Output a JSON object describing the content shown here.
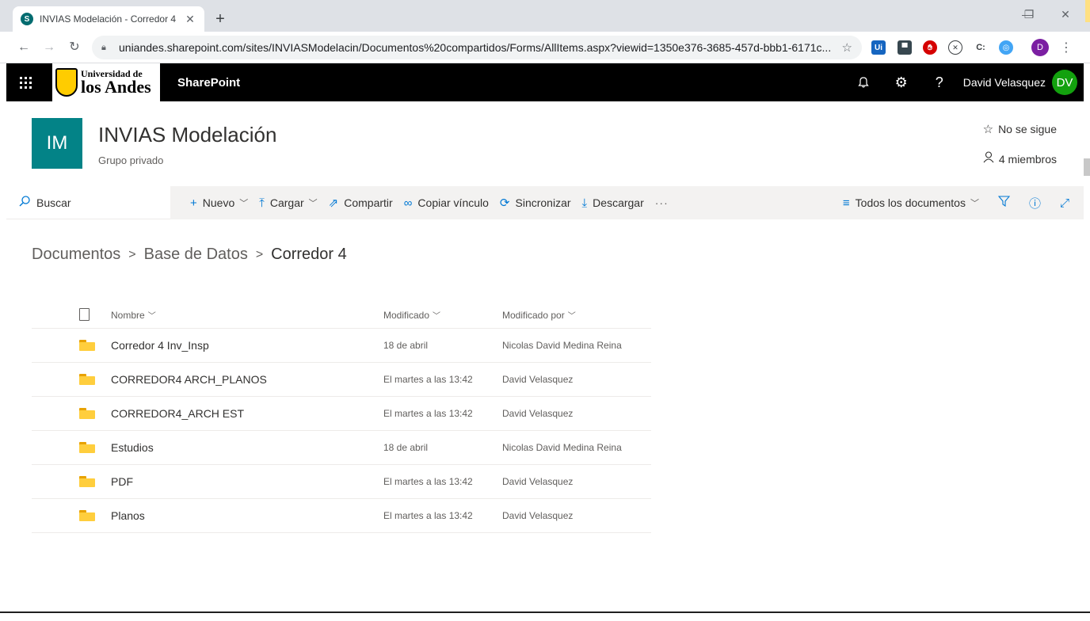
{
  "browser": {
    "tab_title": "INVIAS Modelación - Corredor 4",
    "tab_favicon_letter": "S",
    "url": "uniandes.sharepoint.com/sites/INVIASModelacin/Documentos%20compartidos/Forms/AllItems.aspx?viewid=1350e376-3685-457d-bbb1-6171c...",
    "profile_letter": "D",
    "extensions": [
      "Ui",
      "tv",
      "stop",
      "x",
      "C:",
      "edge"
    ]
  },
  "suitebar": {
    "logo_line1": "Universidad de",
    "logo_line2": "los Andes",
    "brand": "SharePoint",
    "user_name": "David Velasquez",
    "user_initials": "DV"
  },
  "site": {
    "logo_initials": "IM",
    "title": "INVIAS Modelación",
    "subtitle": "Grupo privado",
    "follow_label": "No se sigue",
    "members_label": "4 miembros"
  },
  "commandbar": {
    "search_label": "Buscar",
    "new_label": "Nuevo",
    "upload_label": "Cargar",
    "share_label": "Compartir",
    "copy_link_label": "Copiar vínculo",
    "sync_label": "Sincronizar",
    "download_label": "Descargar",
    "more_label": "···",
    "view_label": "Todos los documentos"
  },
  "breadcrumb": [
    "Documentos",
    "Base de Datos",
    "Corredor 4"
  ],
  "list": {
    "columns": {
      "name": "Nombre",
      "modified": "Modificado",
      "modified_by": "Modificado por"
    },
    "rows": [
      {
        "name": "Corredor 4 Inv_Insp",
        "modified": "18 de abril",
        "modified_by": "Nicolas David Medina Reina"
      },
      {
        "name": "CORREDOR4 ARCH_PLANOS",
        "modified": "El martes a las 13:42",
        "modified_by": "David Velasquez"
      },
      {
        "name": "CORREDOR4_ARCH EST",
        "modified": "El martes a las 13:42",
        "modified_by": "David Velasquez"
      },
      {
        "name": "Estudios",
        "modified": "18 de abril",
        "modified_by": "Nicolas David Medina Reina"
      },
      {
        "name": "PDF",
        "modified": "El martes a las 13:42",
        "modified_by": "David Velasquez"
      },
      {
        "name": "Planos",
        "modified": "El martes a las 13:42",
        "modified_by": "David Velasquez"
      }
    ]
  },
  "colors": {
    "site_logo": "#038387",
    "accent": "#0078d4",
    "avatar": "#13a10e",
    "folder": "#ffce3d"
  }
}
